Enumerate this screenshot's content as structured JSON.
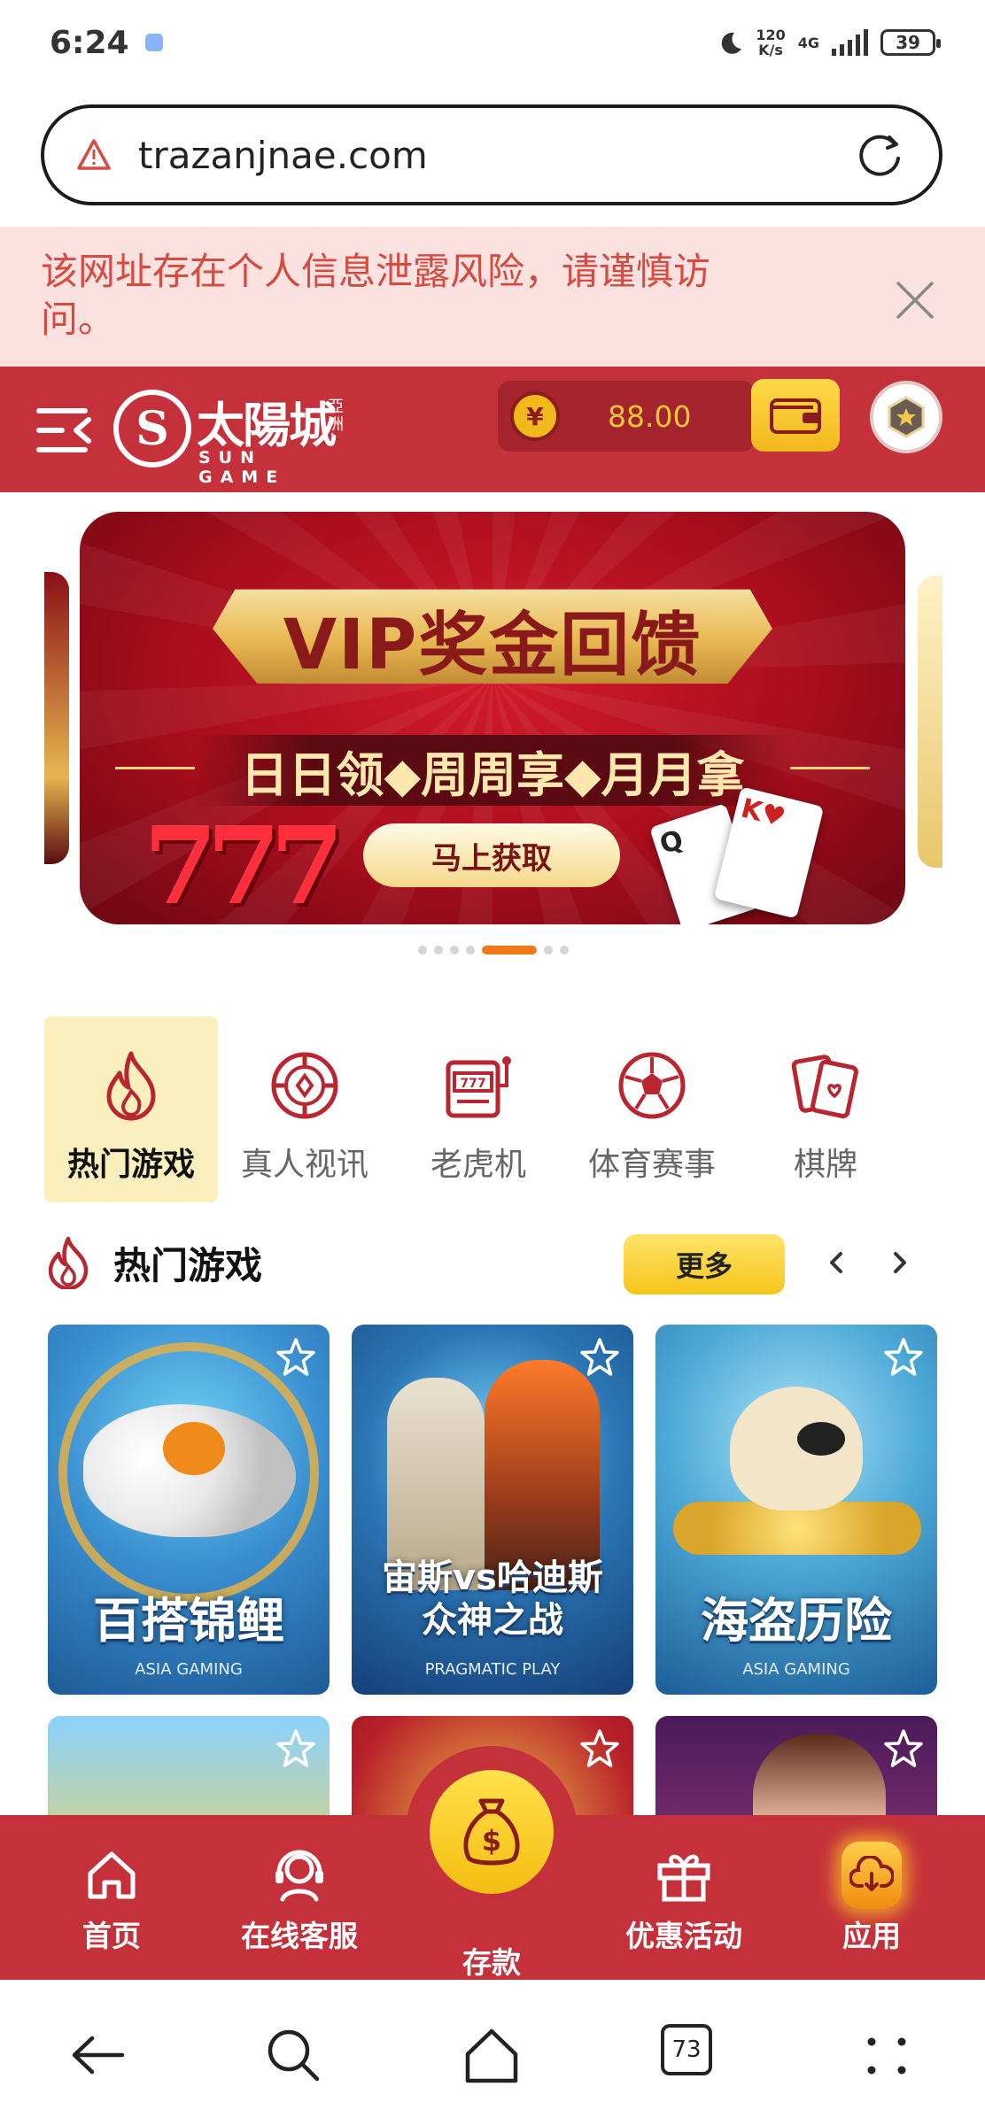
{
  "status_bar": {
    "time": "6:24",
    "speed_value": "120",
    "speed_unit": "K/s",
    "network": "4G",
    "battery": "39"
  },
  "browser": {
    "url": "trazanjnae.com",
    "tabs_count": "73"
  },
  "warning": {
    "text": "该网址存在个人信息泄露风险，请谨慎访问。"
  },
  "site": {
    "logo_cn": "太陽城",
    "logo_side": "亞洲",
    "logo_en": "SUN GAME",
    "logo_emblem": "S",
    "coin_symbol": "¥",
    "balance": "88.00"
  },
  "banner": {
    "title": "VIP奖金回馈",
    "subtitle": "日日领◆周周享◆月月拿",
    "cta": "马上获取",
    "sevens": "777",
    "card1": "Q",
    "card2": "K♥",
    "slide_count": 7,
    "active_slide": 4
  },
  "categories": [
    {
      "label": "热门游戏",
      "icon": "flame-icon",
      "active": true
    },
    {
      "label": "真人视讯",
      "icon": "chip-icon",
      "active": false
    },
    {
      "label": "老虎机",
      "icon": "slot-machine-icon",
      "active": false
    },
    {
      "label": "体育赛事",
      "icon": "soccer-ball-icon",
      "active": false
    },
    {
      "label": "棋牌",
      "icon": "cards-icon",
      "active": false
    }
  ],
  "hot_section": {
    "title": "热门游戏",
    "more_label": "更多"
  },
  "games": [
    {
      "name": "百搭锦鲤",
      "provider": "ASIA GAMING"
    },
    {
      "name": "宙斯vs哈迪斯众神之战",
      "name_line1": "宙斯vs哈迪斯",
      "name_line2": "众神之战",
      "provider": "PRAGMATIC PLAY"
    },
    {
      "name": "海盗历险",
      "provider": "ASIA GAMING"
    }
  ],
  "bottom_nav": [
    {
      "label": "首页",
      "icon": "home-icon"
    },
    {
      "label": "在线客服",
      "icon": "headset-icon"
    },
    {
      "label": "存款",
      "icon": "money-bag-icon"
    },
    {
      "label": "优惠活动",
      "icon": "gift-icon"
    },
    {
      "label": "应用",
      "icon": "app-download-icon"
    }
  ],
  "colors": {
    "brand_red": "#c4313a",
    "gold": "#f5c51a",
    "warning_text": "#d84a3f",
    "warning_bg": "#fbe1df",
    "active_tab_bg": "#fbefbd"
  }
}
